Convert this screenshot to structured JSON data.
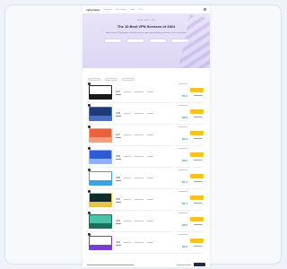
{
  "nav": {
    "logo": "cybernews",
    "links": [
      "Resources",
      "Best Products",
      "News",
      "More"
    ]
  },
  "hero": {
    "breadcrumb": "HOME > BEST > VPN",
    "title": "The 10 Best VPN Services of 2024",
    "subtitle": "Expert-tested VPN providers ranked by security, speed and streaming performance with current deals.",
    "chip_count": 4
  },
  "filters": {
    "count": 3
  },
  "providers": [
    {
      "brand": "#ffffff",
      "accent": "#1b1b1b",
      "score": "4.7",
      "price": "$3.1"
    },
    {
      "brand": "#1e3a78",
      "accent": "#4a6fc7",
      "score": "4.8",
      "price": "$2.9"
    },
    {
      "brand": "#e8633b",
      "accent": "#f2a07c",
      "score": "4.7",
      "price": "$3.4"
    },
    {
      "brand": "#2d5bd6",
      "accent": "#8fb2ff",
      "score": "4.6",
      "price": "$2.0"
    },
    {
      "brand": "#ffffff",
      "accent": "#3aa3e0",
      "score": "4.5",
      "price": "$1.7"
    },
    {
      "brand": "#0f2b2c",
      "accent": "#e5c24a",
      "score": "4.5",
      "price": "$2.1"
    },
    {
      "brand": "#49c2a8",
      "accent": "#1c6e5e",
      "score": "4.4",
      "price": "$2.5"
    },
    {
      "brand": "#ffffff",
      "accent": "#7a3fd0",
      "score": "4.3",
      "price": "$2.2"
    }
  ],
  "colors": {
    "cta": "#f4c22f",
    "price_green": "#16a064",
    "hero_bg": "#e9e4f8"
  },
  "icons": [
    "menu-icon"
  ]
}
